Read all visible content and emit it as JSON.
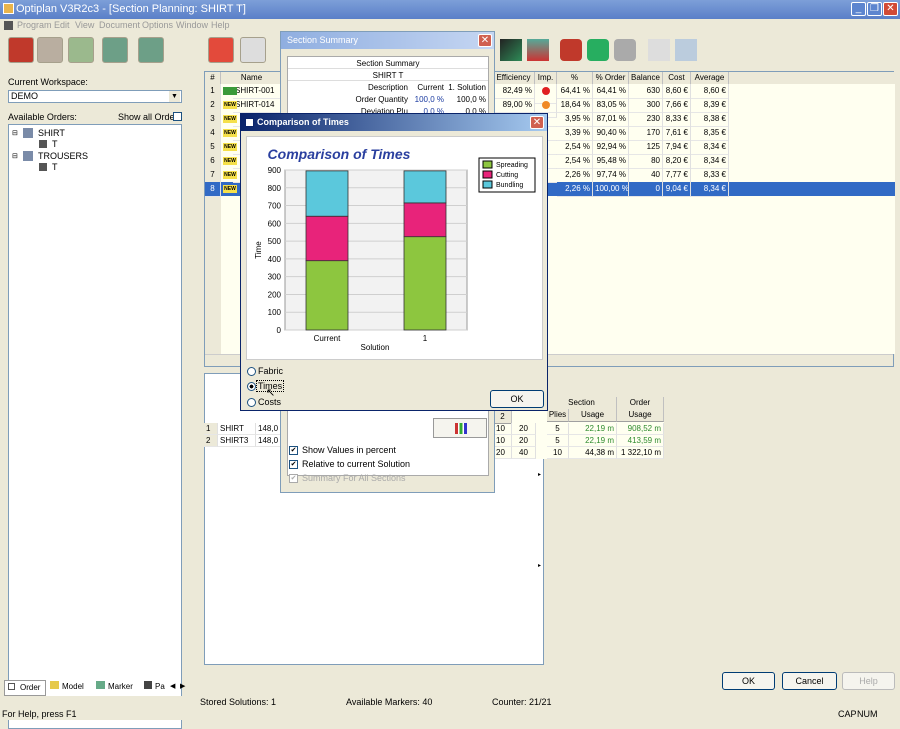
{
  "window": {
    "title": "Optiplan V3R2c3 - [Section Planning: SHIRT T]"
  },
  "menu": [
    "Program",
    "Edit",
    "View",
    "Document",
    "Options",
    "Window",
    "Help"
  ],
  "sidebar": {
    "workspace_label": "Current Workspace:",
    "workspace_value": "DEMO",
    "orders_label": "Available Orders:",
    "show_all_label": "Show all Orders",
    "tree": [
      {
        "label": "SHIRT",
        "child": "T"
      },
      {
        "label": "TROUSERS",
        "child": "T"
      }
    ],
    "tabs": [
      "Order",
      "Model",
      "Marker",
      "Pa"
    ]
  },
  "grid": {
    "headers": [
      "#",
      "Name",
      "Efficiency",
      "Imp.",
      "%",
      "% Order",
      "Balance",
      "Cost",
      "Average"
    ],
    "rows": [
      {
        "n": "1",
        "name": "SHIRT-001",
        "eff": "82,49 %",
        "imp": "red",
        "pct": "64,41 %",
        "order": "64,41 %",
        "bal": "630",
        "cost": "8,60 €",
        "avg": "8,60 €"
      },
      {
        "n": "2",
        "name": "SHIRT-014",
        "eff": "89,00 %",
        "imp": "orange",
        "pct": "18,64 %",
        "order": "83,05 %",
        "bal": "300",
        "cost": "7,66 €",
        "avg": "8,39 €"
      },
      {
        "n": "3",
        "name": "",
        "eff": "",
        "imp": "",
        "pct": "3,95 %",
        "order": "87,01 %",
        "bal": "230",
        "cost": "8,33 €",
        "avg": "8,38 €"
      },
      {
        "n": "4",
        "name": "",
        "eff": "",
        "imp": "",
        "pct": "3,39 %",
        "order": "90,40 %",
        "bal": "170",
        "cost": "7,61 €",
        "avg": "8,35 €"
      },
      {
        "n": "5",
        "name": "",
        "eff": "",
        "imp": "",
        "pct": "2,54 %",
        "order": "92,94 %",
        "bal": "125",
        "cost": "7,94 €",
        "avg": "8,34 €"
      },
      {
        "n": "6",
        "name": "",
        "eff": "",
        "imp": "",
        "pct": "2,54 %",
        "order": "95,48 %",
        "bal": "80",
        "cost": "8,20 €",
        "avg": "8,34 €"
      },
      {
        "n": "7",
        "name": "",
        "eff": "",
        "imp": "",
        "pct": "2,26 %",
        "order": "97,74 %",
        "bal": "40",
        "cost": "7,77 €",
        "avg": "8,33 €"
      },
      {
        "n": "8",
        "name": "",
        "eff": "",
        "imp": "",
        "pct": "2,26 %",
        "order": "100,00 %",
        "bal": "0",
        "cost": "9,04 €",
        "avg": "8,34 €"
      }
    ],
    "new_badge": "NEW"
  },
  "lower_grid": {
    "headers_right": [
      "Section",
      "Order"
    ],
    "subheaders": [
      "Plies",
      "Usage",
      "Usage"
    ],
    "col2": "2",
    "rows": [
      {
        "n": "1",
        "name": "SHIRT",
        "val": "148,0",
        "a": "10",
        "b": "20",
        "plies": "5",
        "usage": "22,19 m",
        "order": "908,52 m"
      },
      {
        "n": "2",
        "name": "SHIRT3",
        "val": "148,0",
        "a": "10",
        "b": "20",
        "plies": "5",
        "usage": "22,19 m",
        "order": "413,59 m"
      },
      {
        "n": "",
        "name": "",
        "val": "",
        "a": "20",
        "b": "40",
        "plies": "10",
        "usage": "44,38 m",
        "order": "1 322,10 m"
      }
    ]
  },
  "section_summary": {
    "title": "Section Summary",
    "heading": "Section Summary",
    "sub": "SHIRT T",
    "col_headers": [
      "Description",
      "Current",
      "1. Solution"
    ],
    "rows": [
      {
        "d": "Order Quantity",
        "c": "100,0 %",
        "s": "100,0 %"
      },
      {
        "d": "Deviation Plu",
        "c": "0,0 %",
        "s": "0,0 %"
      }
    ],
    "options": [
      {
        "label": "Show Values in percent",
        "checked": true,
        "enabled": true
      },
      {
        "label": "Relative to current Solution",
        "checked": true,
        "enabled": true
      },
      {
        "label": "Summary For All Sections",
        "checked": true,
        "enabled": false
      }
    ]
  },
  "comparison": {
    "title": "Comparison of Times",
    "ok_label": "OK",
    "radio": [
      {
        "label": "Fabric",
        "selected": false
      },
      {
        "label": "Times",
        "selected": true
      },
      {
        "label": "Costs",
        "selected": false
      }
    ]
  },
  "chart_data": {
    "type": "bar",
    "stacked": true,
    "title": "Comparison of Times",
    "xlabel": "Solution",
    "ylabel": "Time",
    "categories": [
      "Current",
      "1"
    ],
    "series": [
      {
        "name": "Spreading",
        "color": "#8dc63f",
        "values": [
          390,
          525
        ]
      },
      {
        "name": "Cutting",
        "color": "#e8237a",
        "values": [
          250,
          190
        ]
      },
      {
        "name": "Bundling",
        "color": "#5bc8dc",
        "values": [
          255,
          180
        ]
      }
    ],
    "ylim": [
      0,
      900
    ],
    "yticks": [
      0,
      100,
      200,
      300,
      400,
      500,
      600,
      700,
      800,
      900
    ],
    "legend": "top-right",
    "grid": true
  },
  "buttons": {
    "ok": "OK",
    "cancel": "Cancel",
    "help": "Help"
  },
  "status": {
    "help": "For Help, press F1",
    "stored": "Stored Solutions: 1",
    "markers": "Available Markers: 40",
    "counter": "Counter: 21/21",
    "cap": "CAP",
    "num": "NUM"
  }
}
